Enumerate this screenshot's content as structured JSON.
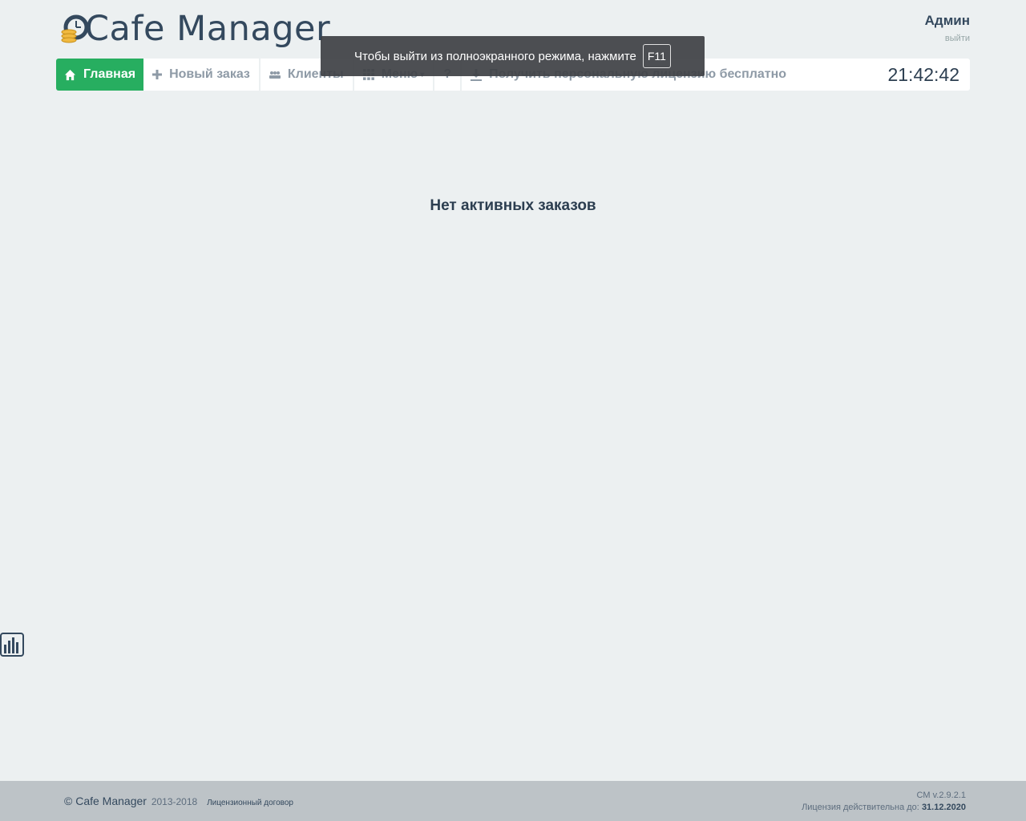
{
  "header": {
    "logo_text": "Cafe Manager",
    "user_name": "Админ",
    "logout_label": "выйти"
  },
  "nav": {
    "home_label": "Главная",
    "new_order_label": "Новый заказ",
    "clients_label": "Клиенты",
    "menu_label": "Меню",
    "help_label": "?",
    "license_label": "Получить персональную лицензию бесплатно",
    "clock": "21:42:42"
  },
  "fullscreen_toast": {
    "message": "Чтобы выйти из полноэкранного режима, нажмите",
    "key": "F11"
  },
  "main": {
    "empty_message": "Нет активных заказов"
  },
  "footer": {
    "copyright": "© Cafe Manager",
    "years": "2013-2018",
    "agreement_link": "Лицензионный договор",
    "version": "CM v.2.9.2.1",
    "license_label": "Лицензия действительна до:",
    "license_date": "31.12.2020"
  },
  "colors": {
    "accent": "#27ae60",
    "background": "#ecf0f1",
    "footer": "#bdc3c7",
    "text_dark": "#2c3e50"
  },
  "icons": [
    "coins-clock-logo-icon",
    "home-icon",
    "plus-icon",
    "users-icon",
    "grid-icon",
    "download-icon",
    "bar-chart-icon"
  ]
}
